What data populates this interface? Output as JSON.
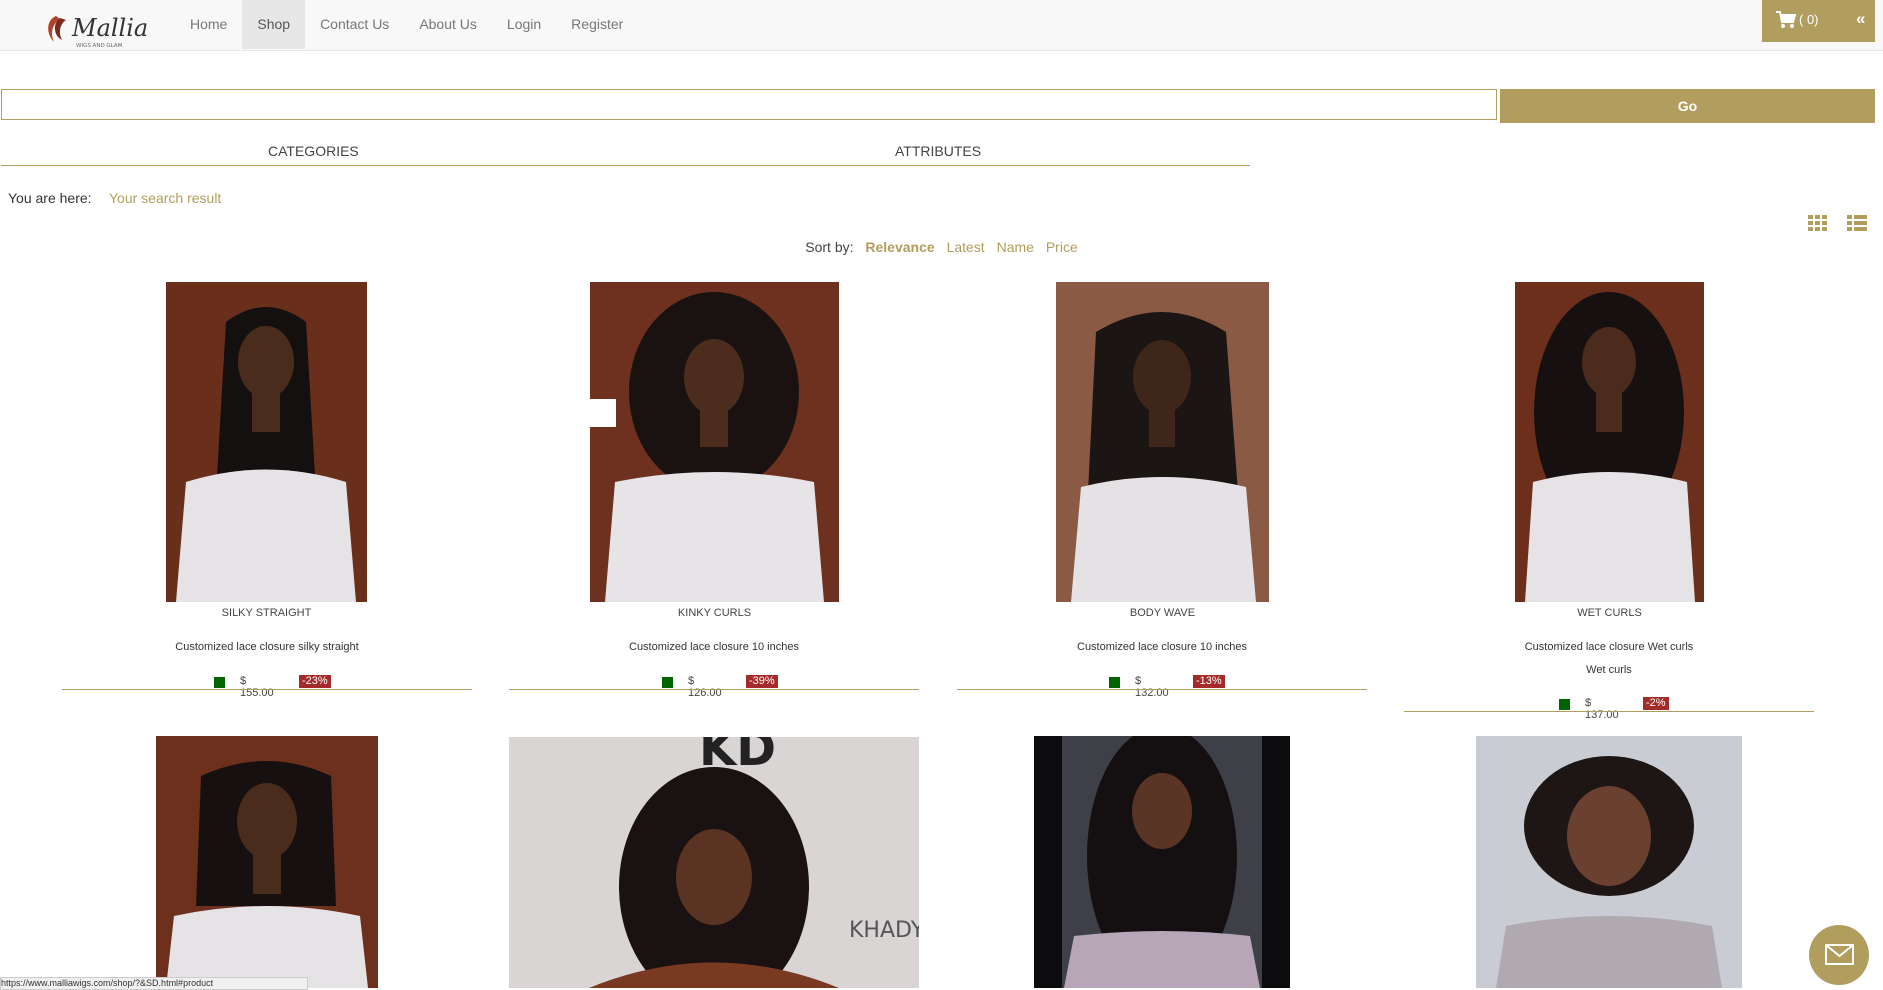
{
  "header": {
    "logo": {
      "title": "Mallia",
      "subtitle": "WIGS AND GLAM"
    },
    "nav": [
      {
        "label": "Home",
        "active": false
      },
      {
        "label": "Shop",
        "active": true
      },
      {
        "label": "Contact Us",
        "active": false
      },
      {
        "label": "About Us",
        "active": false
      },
      {
        "label": "Login",
        "active": false
      },
      {
        "label": "Register",
        "active": false
      }
    ],
    "cart": {
      "count": "( 0)",
      "collapse": "«",
      "icon": "cart-icon"
    }
  },
  "search": {
    "value": "",
    "button": "Go"
  },
  "tabs": {
    "categories": "CATEGORIES",
    "attributes": "ATTRIBUTES"
  },
  "breadcrumb": {
    "prefix": "You are here:",
    "current": "Your search result"
  },
  "sort": {
    "label": "Sort by:",
    "options": [
      "Relevance",
      "Latest",
      "Name",
      "Price"
    ],
    "active": "Relevance"
  },
  "products": [
    {
      "name": "SILKY STRAIGHT",
      "desc": [
        "Customized lace closure silky straight"
      ],
      "price": "$ 155.00",
      "discount": "-23%"
    },
    {
      "name": "KINKY CURLS",
      "desc": [
        "Customized lace closure 10 inches"
      ],
      "price": "$ 126.00",
      "discount": "-39%"
    },
    {
      "name": "BODY WAVE",
      "desc": [
        "Customized lace closure 10 inches"
      ],
      "price": "$ 132.00",
      "discount": "-13%"
    },
    {
      "name": "WET CURLS",
      "desc": [
        "Customized lace closure Wet curls",
        "Wet curls"
      ],
      "price": "$ 137.00",
      "discount": "-2%"
    }
  ],
  "colors": {
    "accent": "#b19e5e",
    "discount": "#a52a2a",
    "swatch": "#006400"
  },
  "status_url": "https://www.malliawigs.com/shop/?&SD.html#product"
}
